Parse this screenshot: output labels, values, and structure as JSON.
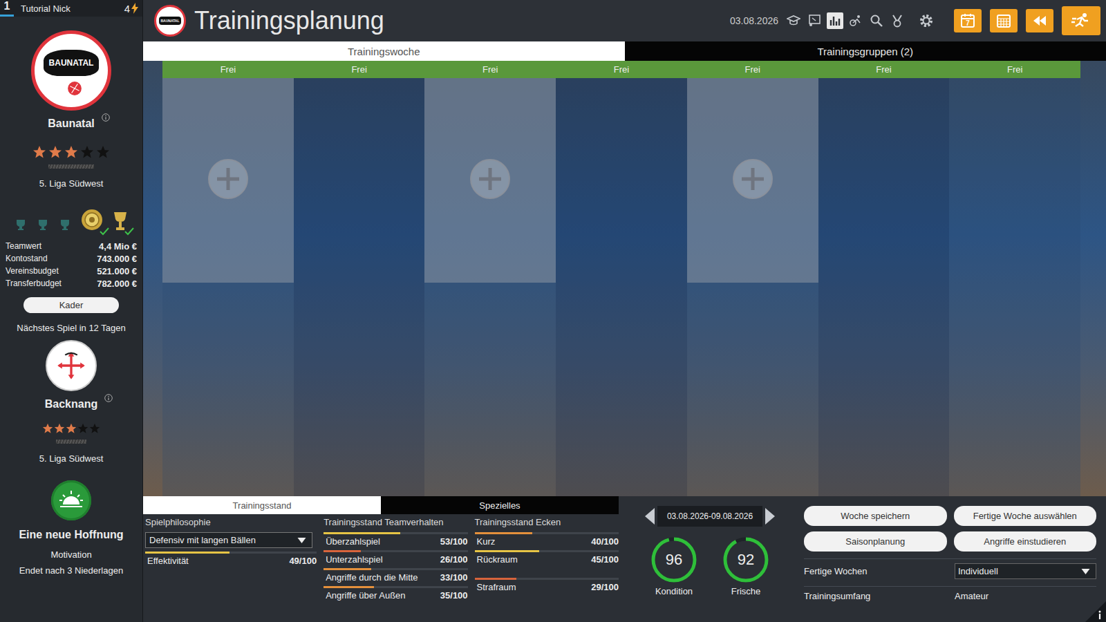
{
  "sidebar": {
    "rank": "1",
    "manager": "Tutorial Nick",
    "points": "4",
    "club": {
      "logo_text": "BAUNATAL",
      "name": "Baunatal",
      "stars": 3,
      "stars_total": 5,
      "league": "5. Liga Südwest"
    },
    "trophies": [
      {
        "kind": "cup",
        "checked": false
      },
      {
        "kind": "cup",
        "checked": false
      },
      {
        "kind": "cup",
        "checked": false
      },
      {
        "kind": "medal",
        "checked": true
      },
      {
        "kind": "trophy",
        "checked": true
      }
    ],
    "stats": [
      {
        "label": "Teamwert",
        "value": "4,4 Mio €"
      },
      {
        "label": "Kontostand",
        "value": "743.000 €"
      },
      {
        "label": "Vereinsbudget",
        "value": "521.000 €"
      },
      {
        "label": "Transferbudget",
        "value": "782.000 €"
      }
    ],
    "kader_button": "Kader",
    "next_match": "Nächstes Spiel in 12 Tagen",
    "opponent": {
      "name": "Backnang",
      "stars": 3,
      "stars_total": 5,
      "league": "5. Liga Südwest"
    },
    "motivation": {
      "title": "Eine neue Hoffnung",
      "label": "Motivation",
      "note": "Endet nach 3 Niederlagen"
    }
  },
  "header": {
    "title": "Trainingsplanung",
    "date": "03.08.2026",
    "tools": [
      {
        "selected": false
      },
      {
        "selected": false
      },
      {
        "selected": true
      },
      {
        "selected": false
      },
      {
        "selected": false
      },
      {
        "selected": false
      }
    ],
    "calendar_day": "7"
  },
  "tabs": [
    {
      "label": "Trainingswoche",
      "selected": true
    },
    {
      "label": "Trainingsgruppen (2)",
      "selected": false
    }
  ],
  "days": [
    {
      "label": "Frei",
      "slot": true
    },
    {
      "label": "Frei",
      "slot": false
    },
    {
      "label": "Frei",
      "slot": true
    },
    {
      "label": "Frei",
      "slot": false
    },
    {
      "label": "Frei",
      "slot": true
    },
    {
      "label": "Frei",
      "slot": false
    },
    {
      "label": "Frei",
      "slot": false
    }
  ],
  "bottom": {
    "tabs": [
      {
        "label": "Trainingsstand",
        "selected": true
      },
      {
        "label": "Spezielles",
        "selected": false
      }
    ],
    "philosophy": {
      "title": "Spielphilosophie",
      "value": "Defensiv mit langen Bällen",
      "effect": {
        "label": "Effektivität",
        "reading": "49/100",
        "level": 0.49
      }
    },
    "team": {
      "title": "Trainingsstand Teamverhalten",
      "rows": [
        {
          "label": "Überzahlspiel",
          "reading": "53/100",
          "level": 0.53
        },
        {
          "label": "Unterzahlspiel",
          "reading": "26/100",
          "level": 0.26
        },
        {
          "label": "Angriffe durch die Mitte",
          "reading": "33/100",
          "level": 0.33
        },
        {
          "label": "Angriffe über Außen",
          "reading": "35/100",
          "level": 0.35
        }
      ]
    },
    "corners": {
      "title": "Trainingsstand Ecken",
      "rows": [
        {
          "label": "Kurz",
          "reading": "40/100",
          "level": 0.4
        },
        {
          "label": "Rückraum",
          "reading": "45/100",
          "level": 0.45
        },
        {
          "label": "Strafraum",
          "reading": "29/100",
          "level": 0.29
        }
      ]
    },
    "week": {
      "range": "03.08.2026-09.08.2026"
    },
    "meters": [
      {
        "label": "Kondition",
        "value": "96",
        "level": 0.96
      },
      {
        "label": "Frische",
        "value": "92",
        "level": 0.92
      }
    ],
    "buttons": [
      "Woche speichern",
      "Fertige Woche auswählen",
      "Saisonplanung",
      "Angriffe einstudieren"
    ],
    "settings": [
      {
        "label": "Fertige Wochen",
        "value": "Individuell",
        "kind": "dropdown"
      },
      {
        "label": "Trainingsumfang",
        "value": "Amateur",
        "kind": "text"
      }
    ]
  }
}
